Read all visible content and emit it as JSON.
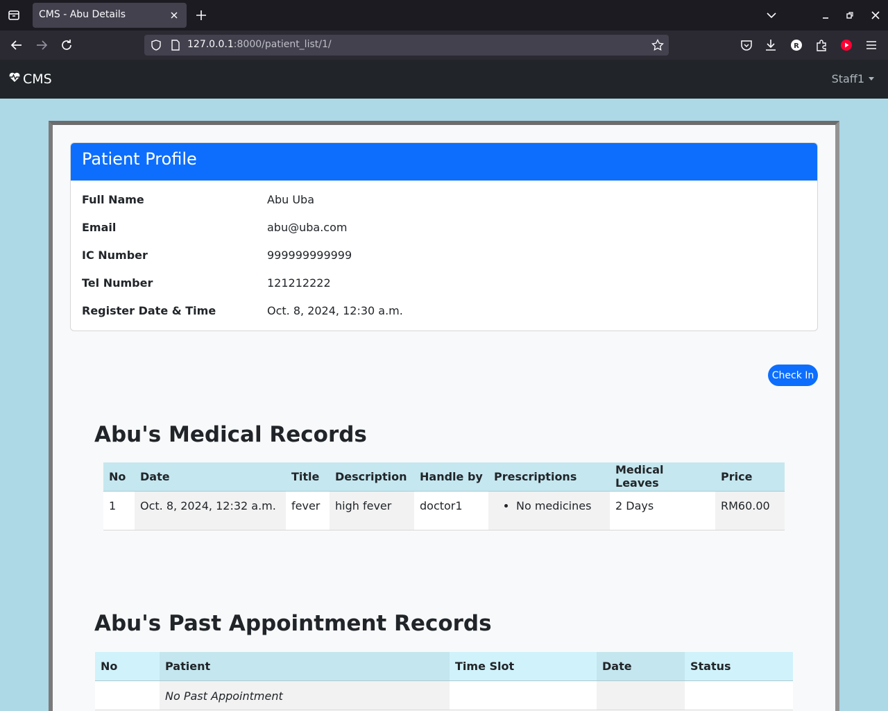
{
  "browser": {
    "tab_title": "CMS - Abu Details",
    "url_host": "127.0.0.1",
    "url_rest": ":8000/patient_list/1/"
  },
  "app": {
    "brand": "CMS",
    "user": "Staff1"
  },
  "profile": {
    "heading": "Patient Profile",
    "fields": [
      {
        "label": "Full Name",
        "value": "Abu Uba"
      },
      {
        "label": "Email",
        "value": "abu@uba.com"
      },
      {
        "label": "IC Number",
        "value": "999999999999"
      },
      {
        "label": "Tel Number",
        "value": "121212222"
      },
      {
        "label": "Register Date & Time",
        "value": "Oct. 8, 2024, 12:30 a.m."
      }
    ]
  },
  "actions": {
    "check_in": "Check In"
  },
  "medical": {
    "heading": "Abu's Medical Records",
    "columns": [
      "No",
      "Date",
      "Title",
      "Description",
      "Handle by",
      "Prescriptions",
      "Medical Leaves",
      "Price"
    ],
    "rows": [
      {
        "no": "1",
        "date": "Oct. 8, 2024, 12:32 a.m.",
        "title": "fever",
        "description": "high fever",
        "handled_by": "doctor1",
        "prescriptions": [
          "No medicines"
        ],
        "leaves": "2 Days",
        "price": "RM60.00"
      }
    ]
  },
  "appointments": {
    "heading": "Abu's Past Appointment Records",
    "columns": [
      "No",
      "Patient",
      "Time Slot",
      "Date",
      "Status"
    ],
    "empty_text": "No Past Appointment"
  }
}
